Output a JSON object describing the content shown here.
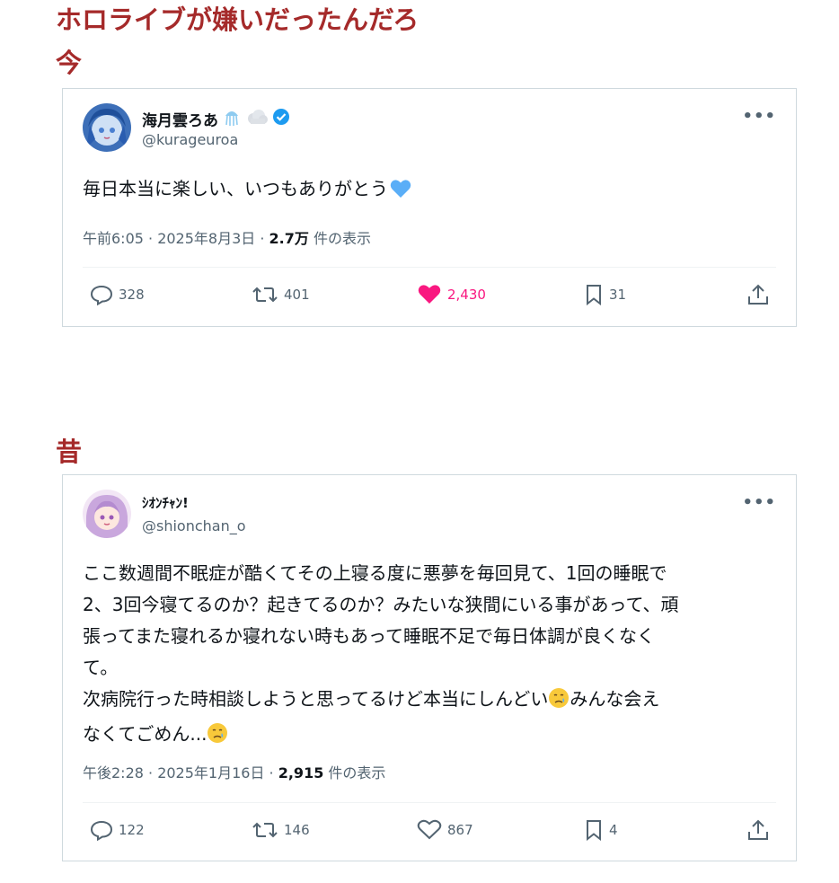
{
  "headline": {
    "line1": "ホロライブが嫌いだったんだろ",
    "line2": "今",
    "line3": "昔"
  },
  "tweets": [
    {
      "name": "海月雲ろあ",
      "handle": "@kurageuroa",
      "text": "毎日本当に楽しい、いつもありがとう",
      "meta": {
        "time": "午前6:05 · 2025年8月3日 · ",
        "views": "2.7万",
        "views_suffix": " 件の表示"
      },
      "actions": {
        "reply": "328",
        "retweet": "401",
        "like": "2,430",
        "bookmark": "31"
      },
      "liked": true,
      "colors": {
        "like": "#f91880",
        "verified": "#1d9bf0",
        "heart_emoji": "#5aaef7"
      }
    },
    {
      "name": "ｼｵﾝﾁｬﾝ!",
      "handle": "@shionchan_o",
      "text": "ここ数週間不眠症が酷くてその上寝る度に悪夢を毎回見て、1回の睡眠で\n2、3回今寝てるのか？起きてるのか？みたいな狭間にいる事があって、頑\n張ってまた寝れるか寝れない時もあって睡眠不足で毎日体調が良くなく\nて。\n次病院行った時相談しようと思ってるけど本当にしんどい",
      "text_tail": "みんな会え\nなくてごめん...",
      "meta": {
        "time": "午後2:28 · 2025年1月16日 · ",
        "views": "2,915",
        "views_suffix": " 件の表示"
      },
      "actions": {
        "reply": "122",
        "retweet": "146",
        "like": "867",
        "bookmark": "4"
      },
      "liked": false
    }
  ],
  "icons": [
    "reply-icon",
    "retweet-icon",
    "like-icon",
    "bookmark-icon",
    "share-icon",
    "verified-icon",
    "more-icon"
  ]
}
